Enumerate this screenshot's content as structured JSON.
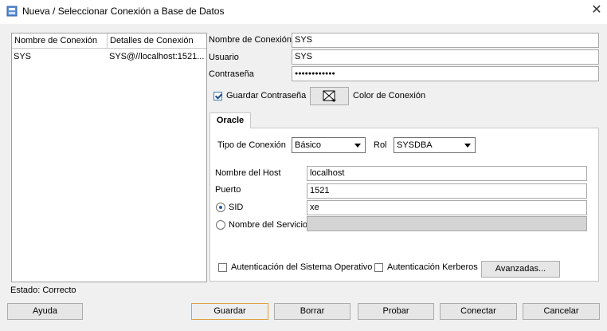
{
  "window": {
    "title": "Nueva / Seleccionar Conexión a Base de Datos",
    "icon": "database-connection-icon",
    "close_icon": "close-icon"
  },
  "connections": {
    "headers": [
      "Nombre de Conexión",
      "Detalles de Conexión"
    ],
    "rows": [
      {
        "name": "SYS",
        "details": "SYS@//localhost:1521..."
      }
    ]
  },
  "form": {
    "nombre_label": "Nombre de Conexión",
    "nombre_value": "SYS",
    "usuario_label": "Usuario",
    "usuario_value": "SYS",
    "contrasena_label": "Contraseña",
    "contrasena_value": "●●●●●●●●●●●●",
    "guardar_contrasena_label": "Guardar Contraseña",
    "guardar_contrasena_checked": true,
    "color_label": "Color de Conexión"
  },
  "tab": {
    "label": "Oracle",
    "tipo_label": "Tipo de Conexión",
    "tipo_value": "Básico",
    "rol_label": "Rol",
    "rol_value": "SYSDBA",
    "host_label": "Nombre del Host",
    "host_value": "localhost",
    "puerto_label": "Puerto",
    "puerto_value": "1521",
    "sid_label": "SID",
    "sid_value": "xe",
    "sid_selected": true,
    "servicio_label": "Nombre del Servicio",
    "servicio_value": "",
    "auth_so_label": "Autenticación del Sistema Operativo",
    "auth_kerberos_label": "Autenticación Kerberos",
    "avanzadas_label": "Avanzadas..."
  },
  "status": "Estado: Correcto",
  "buttons": {
    "ayuda": "Ayuda",
    "guardar": "Guardar",
    "borrar": "Borrar",
    "probar": "Probar",
    "conectar": "Conectar",
    "cancelar": "Cancelar"
  }
}
